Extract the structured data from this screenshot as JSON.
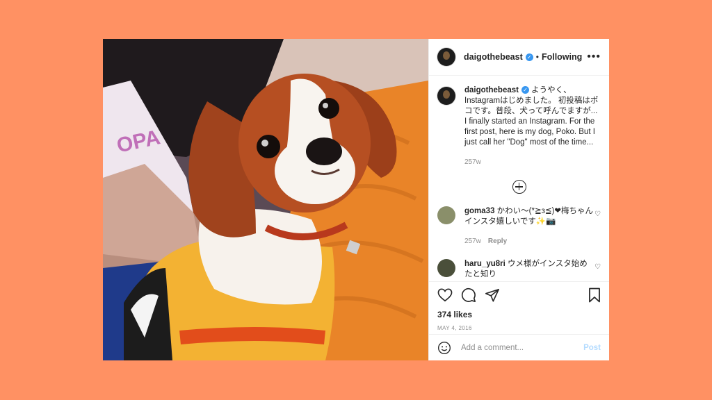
{
  "post": {
    "author": "daigothebeast",
    "follow_status": "Following",
    "more_icon": "more-horizontal-icon",
    "caption": {
      "username": "daigothebeast",
      "text": "ようやく、Instagramはじめました。 初投稿はポコです。普段、犬って呼んでますが... I finally started an Instagram. For the first post, here is my dog, Poko. But I just call her \"Dog\" most of the time...",
      "age": "257w"
    },
    "comments": [
      {
        "username": "goma33",
        "text": "かわい〜(*≧з≦)❤梅ちゃんインスタ嬉しいです✨📷",
        "age": "257w",
        "reply_label": "Reply",
        "avatar_color": "#8a8f6a"
      },
      {
        "username": "haru_yu8ri",
        "text": "ウメ様がインスタ始めたと知り",
        "avatar_color": "#4a4f3a"
      }
    ],
    "likes": "374 likes",
    "date": "MAY 4, 2016",
    "add_comment_placeholder": "Add a comment...",
    "post_button": "Post"
  },
  "colors": {
    "background": "#FF9163",
    "verified": "#3897f0",
    "post_button_disabled": "#b3dbff"
  }
}
